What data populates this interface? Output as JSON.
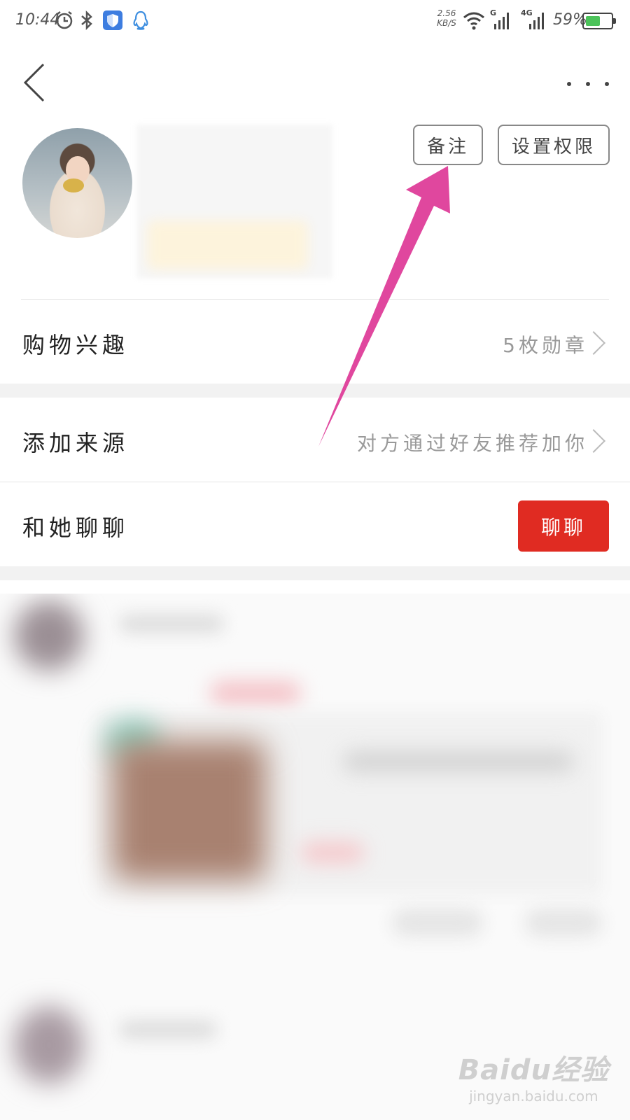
{
  "status_bar": {
    "time": "10:44",
    "net_speed": "2.56",
    "net_unit": "KB/S",
    "signal_1_label": "G",
    "signal_2_label": "4G",
    "battery_percent": "59%",
    "battery_level": 0.59,
    "icons": [
      "alarm-icon",
      "bluetooth-icon",
      "shield-app-icon",
      "qq-icon",
      "wifi-icon",
      "signal-icon",
      "battery-icon"
    ]
  },
  "header": {
    "back_icon": "chevron-left-icon",
    "more_icon": "more-dots-icon"
  },
  "profile": {
    "remark_button": "备注",
    "permission_button": "设置权限"
  },
  "rows": {
    "interest_label": "购物兴趣",
    "interest_value": "5枚勋章",
    "source_label": "添加来源",
    "source_value": "对方通过好友推荐加你",
    "chat_label": "和她聊聊",
    "chat_button": "聊聊"
  },
  "colors": {
    "chat_button_bg": "#e02b22",
    "annotation_arrow": "#e0479e",
    "battery_fill": "#4cc35a"
  },
  "watermark": {
    "logo": "Baidu经验",
    "url": "jingyan.baidu.com"
  }
}
